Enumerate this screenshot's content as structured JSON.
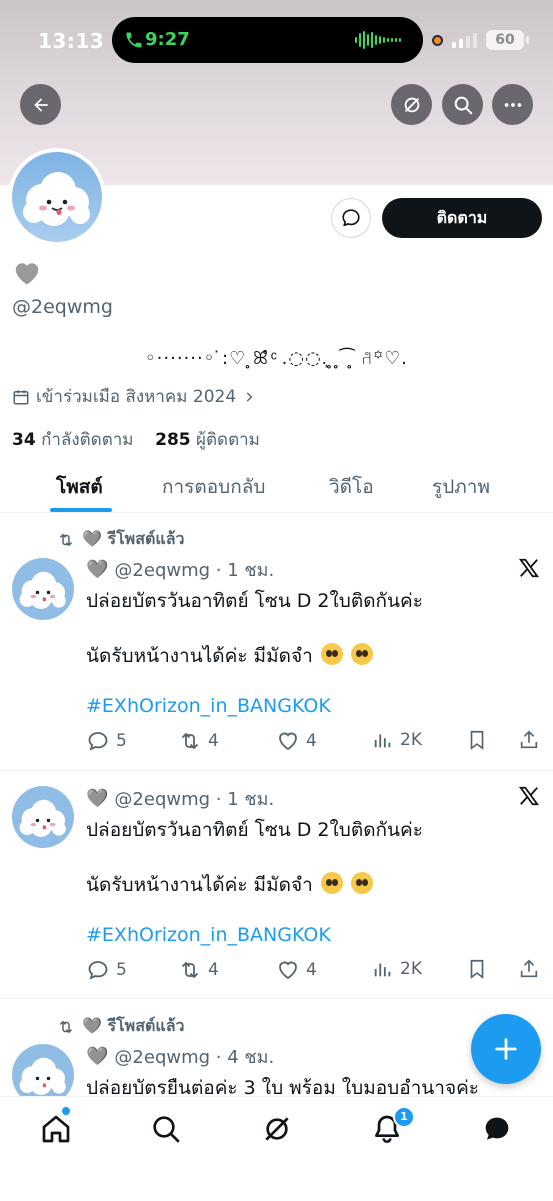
{
  "status_bar": {
    "time": "13:13",
    "call_time": "9:27",
    "battery": "60"
  },
  "profile": {
    "display_name_emoji": "🩶",
    "handle": "@2eqwmg",
    "bio": "◦·······◦ ̇:♡      ̥ꕤ̊ ͨ .◌◌.͙ ̥ ̥ ͡ ̥ ⑁̊꙳♡.",
    "joined": "เข้าร่วมเมือ สิงหาคม 2024",
    "following_count": "34",
    "following_label": "กำลังติดตาม",
    "followers_count": "285",
    "followers_label": "ผู้ติดตาม",
    "follow_button": "ติดตาม"
  },
  "tabs": [
    {
      "label": "โพสต์",
      "active": true
    },
    {
      "label": "การตอบกลับ",
      "active": false
    },
    {
      "label": "วิดีโอ",
      "active": false
    },
    {
      "label": "รูปภาพ",
      "active": false
    }
  ],
  "tweets": [
    {
      "retweet_label": "🩶 รีโพสต์แล้ว",
      "name_emoji": "🩶",
      "handle_time": "@2eqwmg · 1 ชม.",
      "line1": "ปล่อยบัตรวันอาทิตย์ โซน D 2ใบติดกันค่ะ",
      "line2": "นัดรับหน้างานได้ค่ะ มีมัดจำ",
      "hashtag": "#EXhOrizon_in_BANGKOK",
      "replies": "5",
      "reposts": "4",
      "likes": "4",
      "views": "2K"
    },
    {
      "retweet_label": "",
      "name_emoji": "🩶",
      "handle_time": "@2eqwmg · 1 ชม.",
      "line1": "ปล่อยบัตรวันอาทิตย์ โซน D 2ใบติดกันค่ะ",
      "line2": "นัดรับหน้างานได้ค่ะ มีมัดจำ",
      "hashtag": "#EXhOrizon_in_BANGKOK",
      "replies": "5",
      "reposts": "4",
      "likes": "4",
      "views": "2K"
    },
    {
      "retweet_label": "🩶 รีโพสต์แล้ว",
      "name_emoji": "🩶",
      "handle_time": "@2eqwmg · 4 ชม.",
      "line1": "ปล่อยบัตรยืนต่อค่ะ 3 ใบ พร้อม ใบมอบอำนาจค่ะ"
    }
  ],
  "notifications_badge": "1",
  "icons": {
    "back": "arrow-left-icon",
    "grok": "grok-icon",
    "search": "search-icon",
    "more": "more-icon",
    "message": "message-icon",
    "calendar": "calendar-icon",
    "reply": "reply-icon",
    "repost": "repost-icon",
    "like": "heart-icon",
    "views": "views-icon",
    "bookmark": "bookmark-icon",
    "share": "share-icon",
    "x": "x-logo-icon",
    "compose": "plus-icon",
    "home": "home-icon",
    "bell": "bell-icon",
    "chat": "chat-icon"
  },
  "colors": {
    "accent": "#1d9bf0",
    "text": "#0f1419",
    "muted": "#536471"
  }
}
